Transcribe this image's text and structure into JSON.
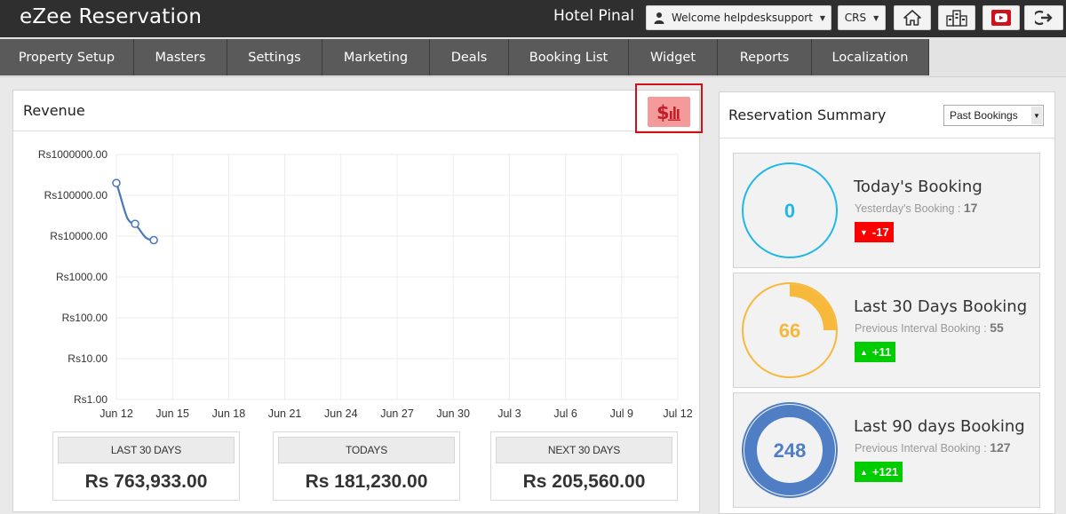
{
  "header": {
    "brand": "eZee Reservation",
    "hotel_name": "Hotel Pinal",
    "welcome": "Welcome helpdesksupport",
    "crs": "CRS",
    "icons": [
      "user-icon",
      "home-icon",
      "hotels-icon",
      "youtube-icon",
      "logout-icon"
    ]
  },
  "nav": {
    "items": [
      "Property Setup",
      "Masters",
      "Settings",
      "Marketing",
      "Deals",
      "Booking List",
      "Widget",
      "Reports",
      "Localization"
    ]
  },
  "revenue": {
    "title": "Revenue",
    "toggle_icon": "dollar-chart-icon",
    "stats": [
      {
        "label": "LAST 30 DAYS",
        "value": "Rs 763,933.00"
      },
      {
        "label": "TODAYS",
        "value": "Rs 181,230.00"
      },
      {
        "label": "NEXT 30 DAYS",
        "value": "Rs 205,560.00"
      }
    ]
  },
  "chart_data": {
    "type": "line",
    "scale": "log",
    "y_ticks": [
      "Rs1000000.00",
      "Rs100000.00",
      "Rs10000.00",
      "Rs1000.00",
      "Rs100.00",
      "Rs10.00",
      "Rs1.00"
    ],
    "x_ticks": [
      "Jun 12",
      "Jun 15",
      "Jun 18",
      "Jun 21",
      "Jun 24",
      "Jun 27",
      "Jun 30",
      "Jul 3",
      "Jul 6",
      "Jul 9",
      "Jul 12"
    ],
    "ylim": [
      1,
      1000000
    ],
    "grid": true,
    "series": [
      {
        "x": [
          "Jun 12",
          "Jun 13",
          "Jun 14"
        ],
        "values": [
          200000,
          20000,
          8000
        ]
      }
    ],
    "color": "#4a78b8"
  },
  "summary": {
    "title": "Reservation Summary",
    "filter": "Past Bookings",
    "cards": [
      {
        "title": "Today's Booking",
        "sub_label": "Yesterday's Booking :",
        "sub_value": "17",
        "count": "0",
        "delta": "-17",
        "direction": "down",
        "color": "#1fb8e8",
        "fill_fraction": 0
      },
      {
        "title": "Last 30 Days Booking",
        "sub_label": "Previous Interval Booking :",
        "sub_value": "55",
        "count": "66",
        "delta": "+11",
        "direction": "up",
        "color": "#f6b93b",
        "fill_fraction": 0.25
      },
      {
        "title": "Last 90 days Booking",
        "sub_label": "Previous Interval Booking :",
        "sub_value": "127",
        "count": "248",
        "delta": "+121",
        "direction": "up",
        "color": "#4f7ec4",
        "fill_fraction": 1
      }
    ]
  }
}
